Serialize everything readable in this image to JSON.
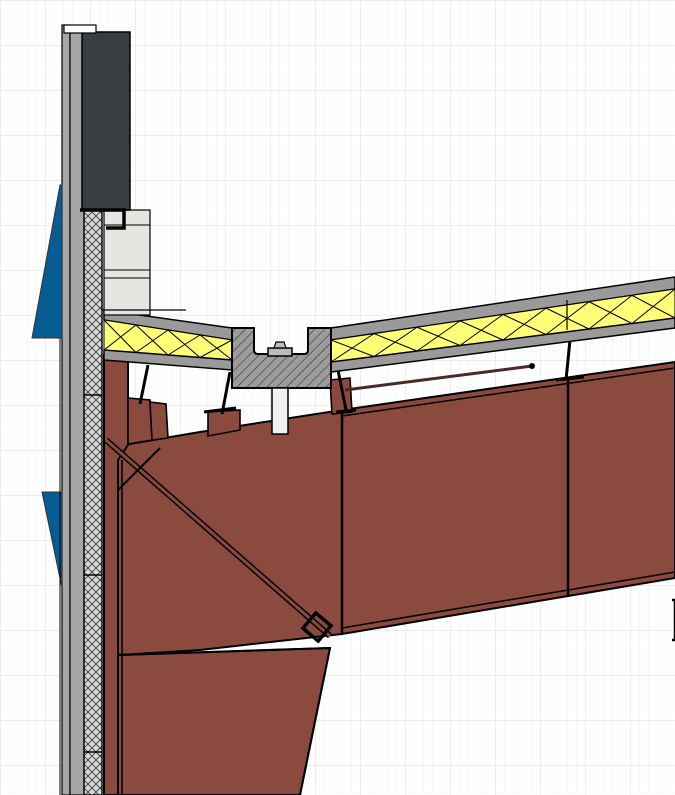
{
  "colors": {
    "background": "#ffffff",
    "grid_minor": "#e9ecef",
    "grid_major": "#d5dae0",
    "steel_frame": "#8b4a3e",
    "steel_outline": "#000000",
    "insulation": "#ffff78",
    "sheeting": "#9a9a9a",
    "gutter": "#9c9c9c",
    "parapet_cap": "#373d40",
    "parapet_panel": "#e4e6e2",
    "wall_cladding": "#a6a6a6",
    "wall_insulation": "#d9d9d9",
    "blue_panel": "#075c93",
    "downpipe": "#f2f2f2"
  },
  "components": [
    "grid-background",
    "wall-cladding",
    "parapet-cap",
    "parapet-panel",
    "blue-fascia-panel",
    "roof-sheeting-left",
    "roof-sheeting-right",
    "box-gutter",
    "downpipe",
    "purlin",
    "steel-rafter",
    "steel-column",
    "haunch-brace",
    "brace-connector",
    "tie-rod"
  ]
}
